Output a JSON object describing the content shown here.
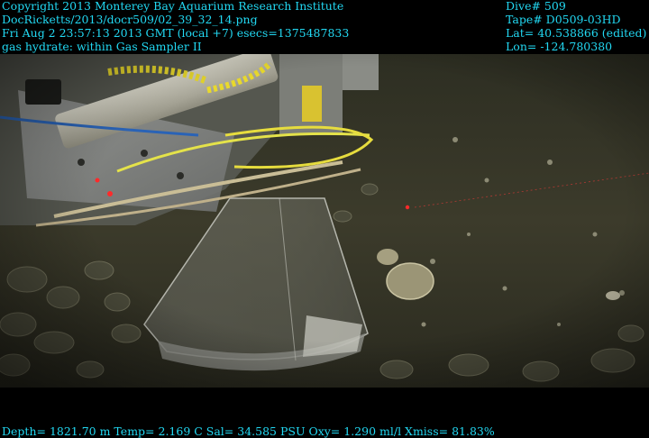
{
  "header": {
    "copyright": "Copyright 2013 Monterey Bay Aquarium Research Institute",
    "file_path": "DocRicketts/2013/docr509/02_39_32_14.png",
    "timestamp": "Fri Aug  2 23:57:13 2013 GMT (local +7)  esecs=1375487833",
    "caption": "gas hydrate: within Gas Sampler II",
    "dive": "Dive# 509",
    "tape": "Tape# D0509-03HD",
    "lat": "Lat= 40.538866 (edited)",
    "lon": "Lon= -124.780380"
  },
  "footer": {
    "sensor_readout": "Depth= 1821.70 m  Temp= 2.169 C  Sal= 34.585 PSU  Oxy= 1.290 ml/l  Xmiss= 81.83%"
  },
  "colors": {
    "overlay_text": "#22d8f2",
    "seafloor": "#3d3b2c",
    "laser": "#ff2a2a",
    "yellow_line": "#e4e24a"
  }
}
